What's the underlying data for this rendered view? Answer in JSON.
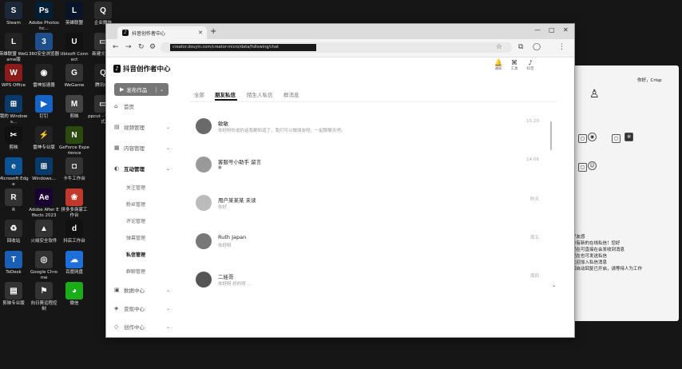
{
  "desktop": {
    "icons": [
      {
        "label": "Steam",
        "glyph": "S",
        "color": "#1b2838"
      },
      {
        "label": "Adobe Photoshc...",
        "glyph": "Ps",
        "color": "#001e36"
      },
      {
        "label": "英雄联盟",
        "glyph": "L",
        "color": "#0a1428"
      },
      {
        "label": "企业微信",
        "glyph": "Q",
        "color": "#2b2b2b"
      },
      {
        "label": "英雄联盟 WeGame版",
        "glyph": "L",
        "color": "#222"
      },
      {
        "label": "360安全浏览器",
        "glyph": "3",
        "color": "#1e4e8c"
      },
      {
        "label": "Ubisoft Connect",
        "glyph": "U",
        "color": "#111"
      },
      {
        "label": "新建文件夹",
        "glyph": "▭",
        "color": "#333"
      },
      {
        "label": "WPS Office",
        "glyph": "W",
        "color": "#8a1c1c"
      },
      {
        "label": "雷神加速器",
        "glyph": "◉",
        "color": "#222"
      },
      {
        "label": "WeGame",
        "glyph": "G",
        "color": "#333"
      },
      {
        "label": "腾讯QQ",
        "glyph": "Q",
        "color": "#222"
      },
      {
        "label": "我的 Windows...",
        "glyph": "⊞",
        "color": "#0a3a6a"
      },
      {
        "label": "钉钉",
        "glyph": "▶",
        "color": "#1463c5"
      },
      {
        "label": "剪映",
        "glyph": "M",
        "color": "#444"
      },
      {
        "label": "ppcut - 快捷方式",
        "glyph": "▭",
        "color": "#333"
      },
      {
        "label": "剪映",
        "glyph": "✂",
        "color": "#111"
      },
      {
        "label": "雷神专业版",
        "glyph": "⚡",
        "color": "#222"
      },
      {
        "label": "GeForce Experience",
        "glyph": "N",
        "color": "#2c4a10"
      },
      {
        "label": "",
        "glyph": "",
        "color": "transparent"
      },
      {
        "label": "Microsoft Edge",
        "glyph": "e",
        "color": "#0b5394"
      },
      {
        "label": "Windows...",
        "glyph": "⊞",
        "color": "#0a3a6a"
      },
      {
        "label": "卡牛工作台",
        "glyph": "◘",
        "color": "#333"
      },
      {
        "label": "",
        "glyph": "",
        "color": "transparent"
      },
      {
        "label": "R",
        "glyph": "R",
        "color": "#333"
      },
      {
        "label": "Adobe After Effects 2023",
        "glyph": "Ae",
        "color": "#1a0033"
      },
      {
        "label": "拼多多商家工作台",
        "glyph": "❀",
        "color": "#c0392b"
      },
      {
        "label": "",
        "glyph": "",
        "color": "transparent"
      },
      {
        "label": "回收站",
        "glyph": "♻",
        "color": "#2b2b2b"
      },
      {
        "label": "火绒安全软件",
        "glyph": "▲",
        "color": "#333"
      },
      {
        "label": "抖店工作台",
        "glyph": "d",
        "color": "#111"
      },
      {
        "label": "",
        "glyph": "",
        "color": "transparent"
      },
      {
        "label": "ToDesk",
        "glyph": "T",
        "color": "#1a5fb4"
      },
      {
        "label": "Google Chrome",
        "glyph": "◎",
        "color": "#333"
      },
      {
        "label": "百度网盘",
        "glyph": "☁",
        "color": "#1e6fd9"
      },
      {
        "label": "",
        "glyph": "",
        "color": "transparent"
      },
      {
        "label": "剪映专业版",
        "glyph": "▤",
        "color": "#333"
      },
      {
        "label": "向日葵远程控制",
        "glyph": "⚑",
        "color": "#333"
      },
      {
        "label": "微信",
        "glyph": "◕",
        "color": "#1aad19"
      }
    ]
  },
  "background_window": {
    "user_text": "你好，Crisp",
    "lines": [
      "好友感",
      "你有新的在线私信！您好",
      "现在可直接在会发收到消息",
      "现在也可发送私信",
      "欢迎加入私信消息",
      "回自动回复已开启，请等待人为工作"
    ]
  },
  "browser": {
    "tab_title": "抖音创作者中心",
    "url": "creator.douyin.com/creator-micro/data/following/chat",
    "window_controls": [
      "—",
      "□",
      "✕"
    ]
  },
  "header": {
    "icons": [
      {
        "name": "bell-icon",
        "glyph": "🔔",
        "label": "通知"
      },
      {
        "name": "tools-icon",
        "glyph": "⌘",
        "label": "工具"
      },
      {
        "name": "tiktok-icon",
        "glyph": "♪",
        "label": "抖音"
      }
    ]
  },
  "sidebar": {
    "logo": "抖音创作者中心",
    "publish_label": "发布作品",
    "items": [
      {
        "icon": "⌂",
        "label": "首页",
        "has_caret": false,
        "bold": false
      },
      {
        "icon": "▤",
        "label": "视频管理",
        "has_caret": true,
        "bold": false
      },
      {
        "icon": "▦",
        "label": "内容管理",
        "has_caret": true,
        "bold": false
      },
      {
        "icon": "◐",
        "label": "互动管理",
        "has_caret": true,
        "bold": true
      }
    ],
    "subitems": [
      "关注管理",
      "粉丝管理",
      "评论管理",
      "弹幕管理",
      "私信管理",
      "群聊管理"
    ],
    "active_sub": 4,
    "bottom_items": [
      {
        "icon": "▣",
        "label": "数据中心"
      },
      {
        "icon": "◈",
        "label": "变现中心"
      },
      {
        "icon": "◇",
        "label": "创作中心"
      }
    ]
  },
  "tabs": [
    "全部",
    "朋友私信",
    "陌生人私信",
    "群消息"
  ],
  "active_tab": 1,
  "messages": [
    {
      "name": "敏敏",
      "preview": "你好呀你说的话我都知道了，我们可以做朋友呀，一起聊聊天吧。",
      "time": "15:20",
      "avatar": "#6a6a6a"
    },
    {
      "name": "客服号小助手 留言",
      "preview": "●",
      "time": "14:06",
      "avatar": "#999"
    },
    {
      "name": "用户某某某 未读",
      "preview": "你好",
      "time": "昨天",
      "avatar": "#bbb"
    },
    {
      "name": "Ruth Japan",
      "preview": "你好呀",
      "time": "周五",
      "avatar": "#777"
    },
    {
      "name": "二娃哥",
      "preview": "你好呀 好的呀 ...",
      "time": "周四",
      "avatar": "#555"
    }
  ]
}
